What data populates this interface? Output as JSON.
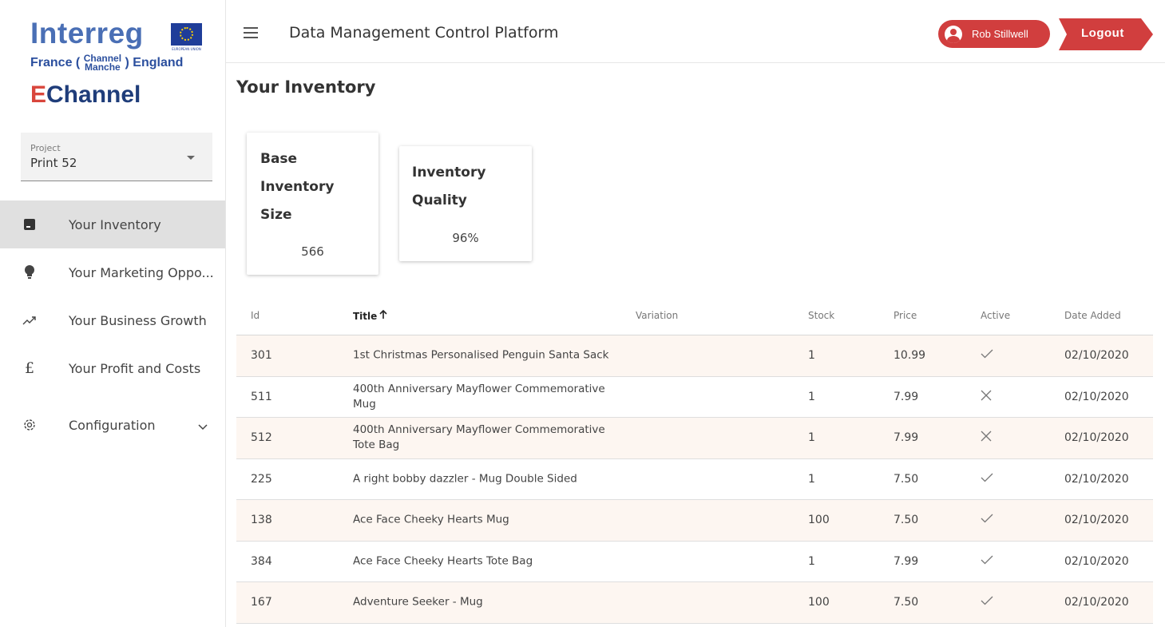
{
  "logo": {
    "brand": "Interreg",
    "eu_caption": "EUROPEAN UNION",
    "region_left": "France (",
    "region_top": "Channel",
    "region_bottom": "Manche",
    "region_right": ") England",
    "product_e": "E",
    "product_rest": "Channel"
  },
  "project": {
    "label": "Project",
    "value": "Print 52"
  },
  "nav": {
    "items": [
      {
        "label": "Your Inventory",
        "icon": "inventory-icon",
        "active": true
      },
      {
        "label": "Your Marketing Oppo...",
        "icon": "lightbulb-icon"
      },
      {
        "label": "Your Business Growth",
        "icon": "trending-up-icon"
      },
      {
        "label": "Your Profit and Costs",
        "icon": "pound-icon"
      },
      {
        "label": "Configuration",
        "icon": "gear-icon",
        "expandable": true
      }
    ]
  },
  "header": {
    "title": "Data Management Control Platform",
    "user_name": "Rob Stillwell",
    "logout_label": "Logout"
  },
  "page": {
    "title": "Your Inventory"
  },
  "cards": {
    "base_inventory": {
      "title": "Base Inventory Size",
      "value": "566"
    },
    "inventory_quality": {
      "title": "Inventory Quality",
      "value": "96%"
    }
  },
  "table": {
    "columns": {
      "id": "Id",
      "title": "Title",
      "variation": "Variation",
      "stock": "Stock",
      "price": "Price",
      "active": "Active",
      "date_added": "Date Added"
    },
    "sort": {
      "column": "title",
      "direction": "asc"
    },
    "rows": [
      {
        "id": "301",
        "title": "1st Christmas Personalised Penguin Santa Sack",
        "variation": "",
        "stock": "1",
        "price": "10.99",
        "active": true,
        "date_added": "02/10/2020"
      },
      {
        "id": "511",
        "title": "400th Anniversary Mayflower Commemorative Mug",
        "variation": "",
        "stock": "1",
        "price": "7.99",
        "active": false,
        "date_added": "02/10/2020"
      },
      {
        "id": "512",
        "title": "400th Anniversary Mayflower Commemorative Tote Bag",
        "variation": "",
        "stock": "1",
        "price": "7.99",
        "active": false,
        "date_added": "02/10/2020"
      },
      {
        "id": "225",
        "title": "A right bobby dazzler - Mug Double Sided",
        "variation": "",
        "stock": "1",
        "price": "7.50",
        "active": true,
        "date_added": "02/10/2020"
      },
      {
        "id": "138",
        "title": "Ace Face Cheeky Hearts Mug",
        "variation": "",
        "stock": "100",
        "price": "7.50",
        "active": true,
        "date_added": "02/10/2020"
      },
      {
        "id": "384",
        "title": "Ace Face Cheeky Hearts Tote Bag",
        "variation": "",
        "stock": "1",
        "price": "7.99",
        "active": true,
        "date_added": "02/10/2020"
      },
      {
        "id": "167",
        "title": "Adventure Seeker - Mug",
        "variation": "",
        "stock": "100",
        "price": "7.50",
        "active": true,
        "date_added": "02/10/2020"
      }
    ]
  },
  "colors": {
    "accent_red": "#d13e3e",
    "brand_blue": "#4a6fb5",
    "row_alt": "#fdf6f1",
    "active_row": "#e0e0e0"
  }
}
